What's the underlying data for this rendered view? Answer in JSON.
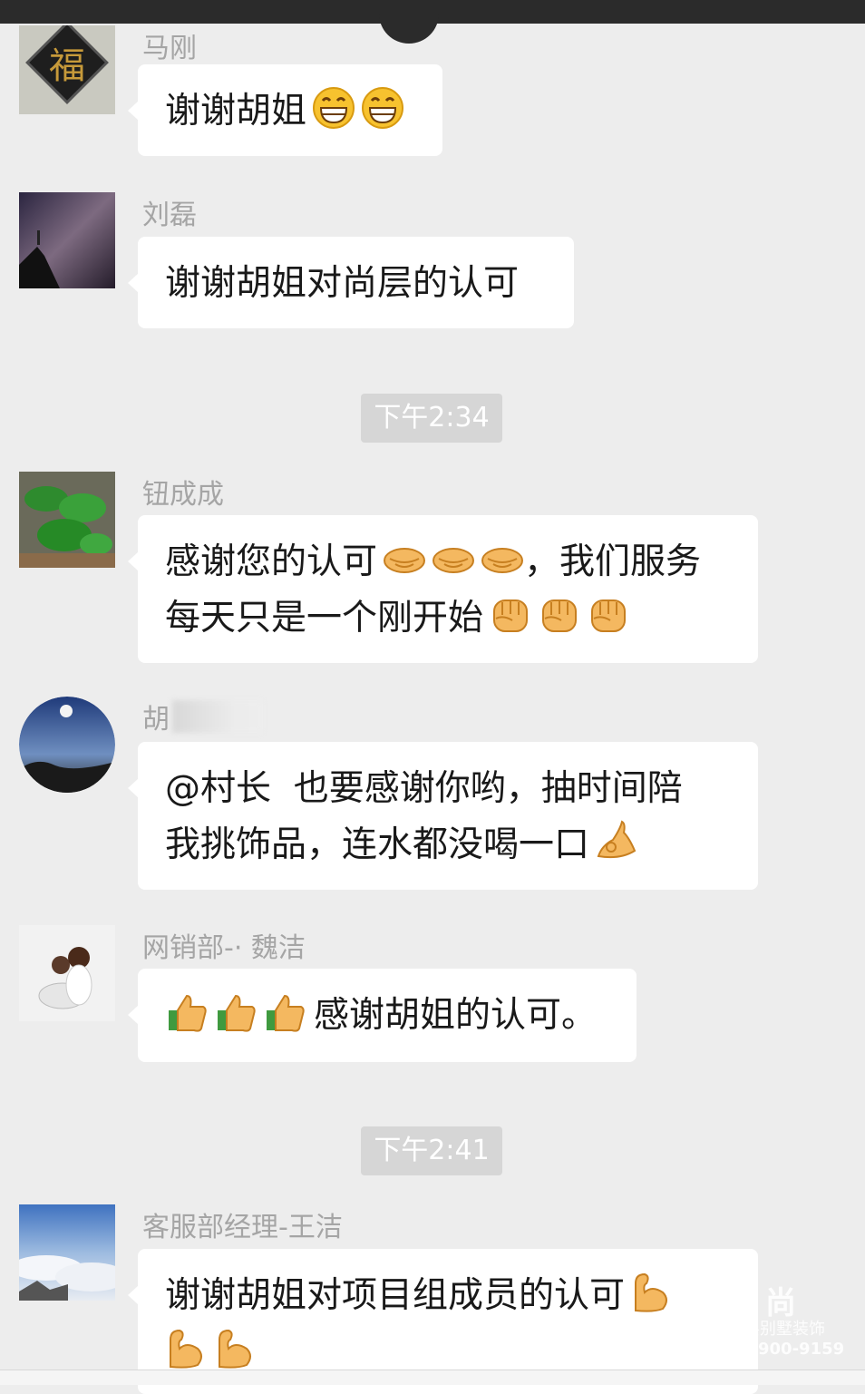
{
  "chat": {
    "messages": [
      {
        "sender": "马刚",
        "avatar": "fu-character-avatar",
        "lines": [
          {
            "text": "谢谢胡姐",
            "emojis_after": [
              "grin",
              "grin"
            ]
          }
        ]
      },
      {
        "sender": "刘磊",
        "avatar": "night-sky-avatar",
        "lines": [
          {
            "text": "谢谢胡姐对尚层的认可",
            "emojis_after": []
          }
        ]
      },
      {
        "sender": "钮成成",
        "avatar": "green-leaves-avatar",
        "lines": [
          {
            "text": "感谢您的认可",
            "emojis_after": [
              "handshake",
              "handshake",
              "handshake"
            ],
            "text_after": "，我们服务"
          },
          {
            "text": "每天只是一个刚开始",
            "emojis_after": [
              "fist",
              "fist",
              "fist"
            ]
          }
        ]
      },
      {
        "sender": "胡",
        "avatar": "moon-landscape-avatar",
        "lines": [
          {
            "text": "@村长  也要感谢你哟，抽时间陪"
          },
          {
            "text": "我挑饰品，连水都没喝一口",
            "emojis_after": [
              "ok-hand"
            ]
          }
        ]
      },
      {
        "sender": "网销部-· 魏洁",
        "avatar": "mother-child-avatar",
        "lines": [
          {
            "emojis_before": [
              "thumbs-up",
              "thumbs-up",
              "thumbs-up"
            ],
            "text": "感谢胡姐的认可。"
          }
        ]
      },
      {
        "sender": "客服部经理-王洁",
        "avatar": "sea-of-clouds-avatar",
        "lines": [
          {
            "text": "谢谢胡姐对项目组成员的认可",
            "emojis_after": [
              "flexed-biceps"
            ]
          },
          {
            "emojis_before": [
              "flexed-biceps",
              "flexed-biceps"
            ],
            "text": ""
          }
        ]
      }
    ],
    "timestamps": [
      "下午2:34",
      "下午2:41"
    ]
  },
  "watermark": {
    "name": "尚层别墅装饰",
    "phone": "900-9159"
  },
  "colors": {
    "background": "#ededed",
    "bubble": "#ffffff",
    "sender": "#a5a5a5",
    "timestamp_bg": "#d6d6d6"
  }
}
